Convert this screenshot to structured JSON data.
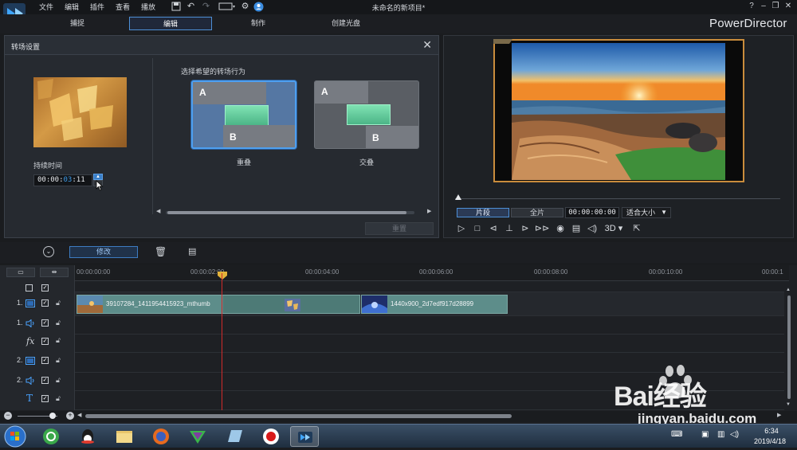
{
  "window": {
    "menu": [
      "文件",
      "编辑",
      "插件",
      "查看",
      "播放"
    ],
    "project_title": "未命名的新项目*",
    "help": "?",
    "brand": "PowerDirector"
  },
  "modes": [
    {
      "label": "捕捉",
      "active": false
    },
    {
      "label": "编辑",
      "active": true
    },
    {
      "label": "制作",
      "active": false
    },
    {
      "label": "创建光盘",
      "active": false
    }
  ],
  "transition_panel": {
    "title": "转场设置",
    "duration_label": "持续时间",
    "duration": {
      "pre": "00:00:",
      "highlight": "03",
      "post": ":11"
    },
    "behavior_label": "选择希望的转场行为",
    "options": [
      {
        "caption": "重叠",
        "selected": true,
        "a": "A",
        "b": "B"
      },
      {
        "caption": "交叠",
        "selected": false,
        "a": "A",
        "b": "B"
      }
    ],
    "apply_button": "重置"
  },
  "preview": {
    "clip_tab": "片段",
    "movie_tab": "全片",
    "timecode": "00:00:00:00",
    "fit": "适合大小",
    "mode_3d": "3D"
  },
  "edit_toolbar": {
    "modify_button": "修改"
  },
  "timeline": {
    "ruler_ticks": [
      "00:00:00:00",
      "00:00:02:00",
      "00:00:04:00",
      "00:00:06:00",
      "00:00:08:00",
      "00:00:10:00",
      "00:00:1"
    ],
    "tracks": [
      {
        "label": "1.",
        "kind": "video"
      },
      {
        "label": "1.",
        "kind": "audio"
      },
      {
        "label": "fx",
        "kind": "effect"
      },
      {
        "label": "2.",
        "kind": "video"
      },
      {
        "label": "2.",
        "kind": "audio"
      },
      {
        "label": "T",
        "kind": "title"
      }
    ],
    "clips": [
      {
        "name": "39107284_1411954415923_mthumb"
      },
      {
        "name": "1440x900_2d7edf917d28899"
      }
    ]
  },
  "taskbar": {
    "time": "6:34",
    "date": "2019/4/18"
  },
  "watermark": {
    "logo_text": "Bai经验",
    "url": "jingyan.baidu.com"
  },
  "colors": {
    "accent": "#4d8fd6",
    "playhead": "#d22a2a",
    "clip": "#5d8d8a",
    "transition_highlight": "#4cb587"
  }
}
